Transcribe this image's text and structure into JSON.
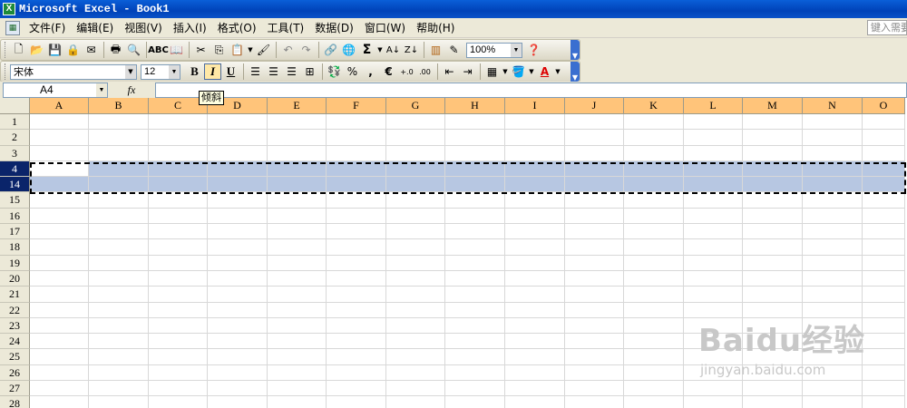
{
  "window": {
    "title": "Microsoft Excel - Book1",
    "app_icon": "excel-icon"
  },
  "menubar": {
    "items": [
      "文件(F)",
      "编辑(E)",
      "视图(V)",
      "插入(I)",
      "格式(O)",
      "工具(T)",
      "数据(D)",
      "窗口(W)",
      "帮助(H)"
    ],
    "help_placeholder": "键入需要"
  },
  "toolbar_standard": {
    "zoom": "100%"
  },
  "toolbar_format": {
    "font": "宋体",
    "size": "12",
    "bold": "B",
    "italic": "I",
    "underline": "U",
    "percent": "%",
    "comma": ",",
    "euro": "€"
  },
  "formula_bar": {
    "name_box": "A4",
    "fx": "fx",
    "value": ""
  },
  "tooltip": {
    "text": "倾斜"
  },
  "grid": {
    "columns": [
      "A",
      "B",
      "C",
      "D",
      "E",
      "F",
      "G",
      "H",
      "I",
      "J",
      "K",
      "L",
      "M",
      "N",
      "O"
    ],
    "rows": [
      "1",
      "2",
      "3",
      "4",
      "14",
      "15",
      "16",
      "17",
      "18",
      "19",
      "20",
      "21",
      "22",
      "23",
      "24",
      "25",
      "26",
      "27",
      "28"
    ],
    "selected_rows": [
      "4",
      "14"
    ],
    "active_cell": "A4"
  },
  "colors": {
    "column_header": "#ffc47a",
    "selection": "#b7c7e2",
    "selected_row_header": "#0a246a"
  },
  "watermark": {
    "main": "Baidu经验",
    "sub": "jingyan.baidu.com"
  }
}
